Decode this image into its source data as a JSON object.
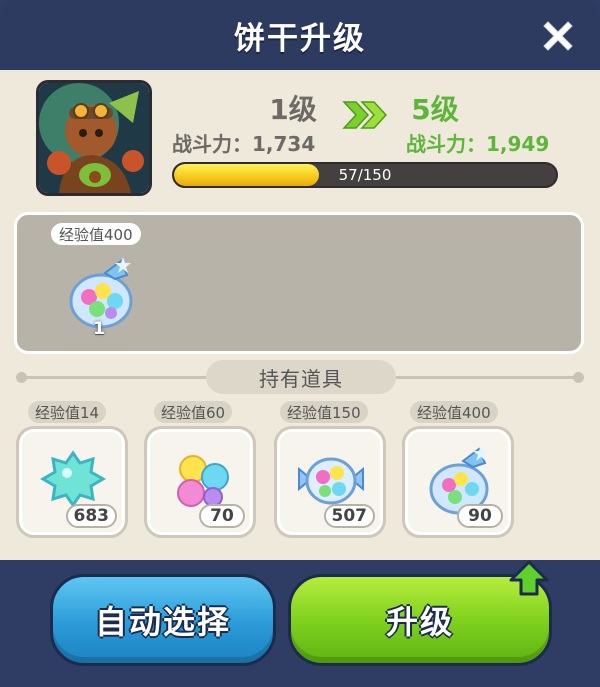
{
  "title": "饼干升级",
  "icons": {
    "close": "close-icon",
    "arrows": "double-chevron-right-icon",
    "upgrade_hint": "up-arrow-icon"
  },
  "colors": {
    "header_bg": "#2e3b61",
    "body_bg": "#efe9dc",
    "next_level_green": "#5db53a",
    "xp_fill": "#f7c81b",
    "auto_button": "#2a9bd8",
    "upgrade_button": "#7ccf1c"
  },
  "current": {
    "level": "1级",
    "power": "战斗力：1,734"
  },
  "next": {
    "level": "5级",
    "power": "战斗力：1,949"
  },
  "xp": {
    "text": "57/150",
    "fraction": 0.38
  },
  "selected": {
    "items": [
      {
        "exp_label": "经验值400",
        "count": "1",
        "icon": "star-candy-bag-icon"
      }
    ]
  },
  "inventory": {
    "title": "持有道具",
    "items": [
      {
        "exp_label": "经验值14",
        "count": "683",
        "icon": "blue-star-jelly-icon"
      },
      {
        "exp_label": "经验值60",
        "count": "70",
        "icon": "star-jelly-bundle-icon"
      },
      {
        "exp_label": "经验值150",
        "count": "507",
        "icon": "candy-bag-icon"
      },
      {
        "exp_label": "经验值400",
        "count": "90",
        "icon": "star-candy-bag-icon"
      }
    ]
  },
  "buttons": {
    "auto_select": "自动选择",
    "upgrade": "升级"
  }
}
